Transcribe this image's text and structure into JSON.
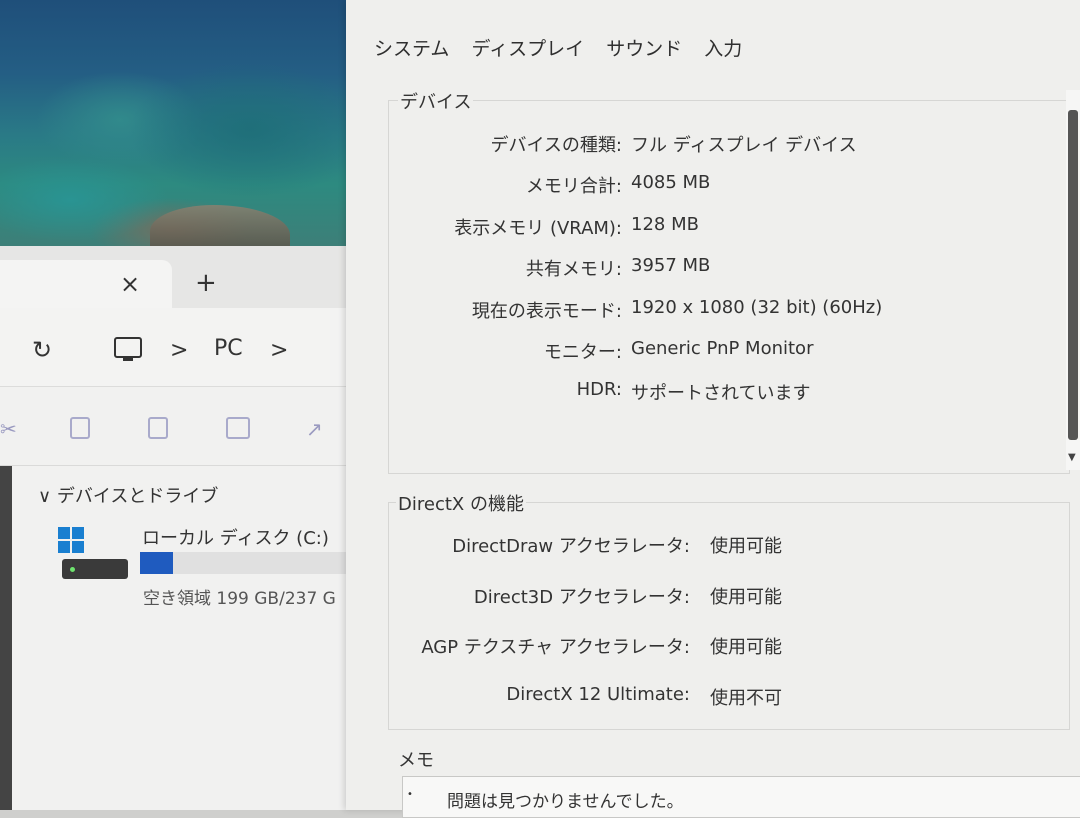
{
  "explorer": {
    "tab_close_glyph": "×",
    "tab_new_glyph": "+",
    "breadcrumb": {
      "chevron": ">",
      "location": "PC"
    },
    "section_header": "∨ デバイスとドライブ",
    "drive": {
      "name": "ローカル ディスク (C:)",
      "free_space": "空き領域 199 GB/237 G",
      "used_fraction": 0.16,
      "bar_color": "#1f5bbf"
    }
  },
  "dxdiag": {
    "tabs": [
      "システム",
      "ディスプレイ",
      "サウンド",
      "入力"
    ],
    "device_group": {
      "title": "デバイス",
      "rows": [
        {
          "label": "デバイスの種類:",
          "value": "フル ディスプレイ デバイス"
        },
        {
          "label": "メモリ合計:",
          "value": "4085 MB"
        },
        {
          "label": "表示メモリ (VRAM):",
          "value": "128 MB"
        },
        {
          "label": "共有メモリ:",
          "value": "3957 MB"
        },
        {
          "label": "現在の表示モード:",
          "value": "1920 x 1080 (32 bit) (60Hz)"
        },
        {
          "label": "モニター:",
          "value": "Generic PnP Monitor"
        },
        {
          "label": "HDR:",
          "value": "サポートされています"
        }
      ]
    },
    "directx_group": {
      "title": "DirectX の機能",
      "rows": [
        {
          "label": "DirectDraw アクセラレータ:",
          "value": "使用可能"
        },
        {
          "label": "Direct3D アクセラレータ:",
          "value": "使用可能"
        },
        {
          "label": "AGP テクスチャ アクセラレータ:",
          "value": "使用可能"
        },
        {
          "label": "DirectX 12 Ultimate:",
          "value": "使用不可"
        }
      ]
    },
    "memo_group": {
      "title": "メモ",
      "bullet": "•",
      "text": "問題は見つかりませんでした。"
    }
  }
}
